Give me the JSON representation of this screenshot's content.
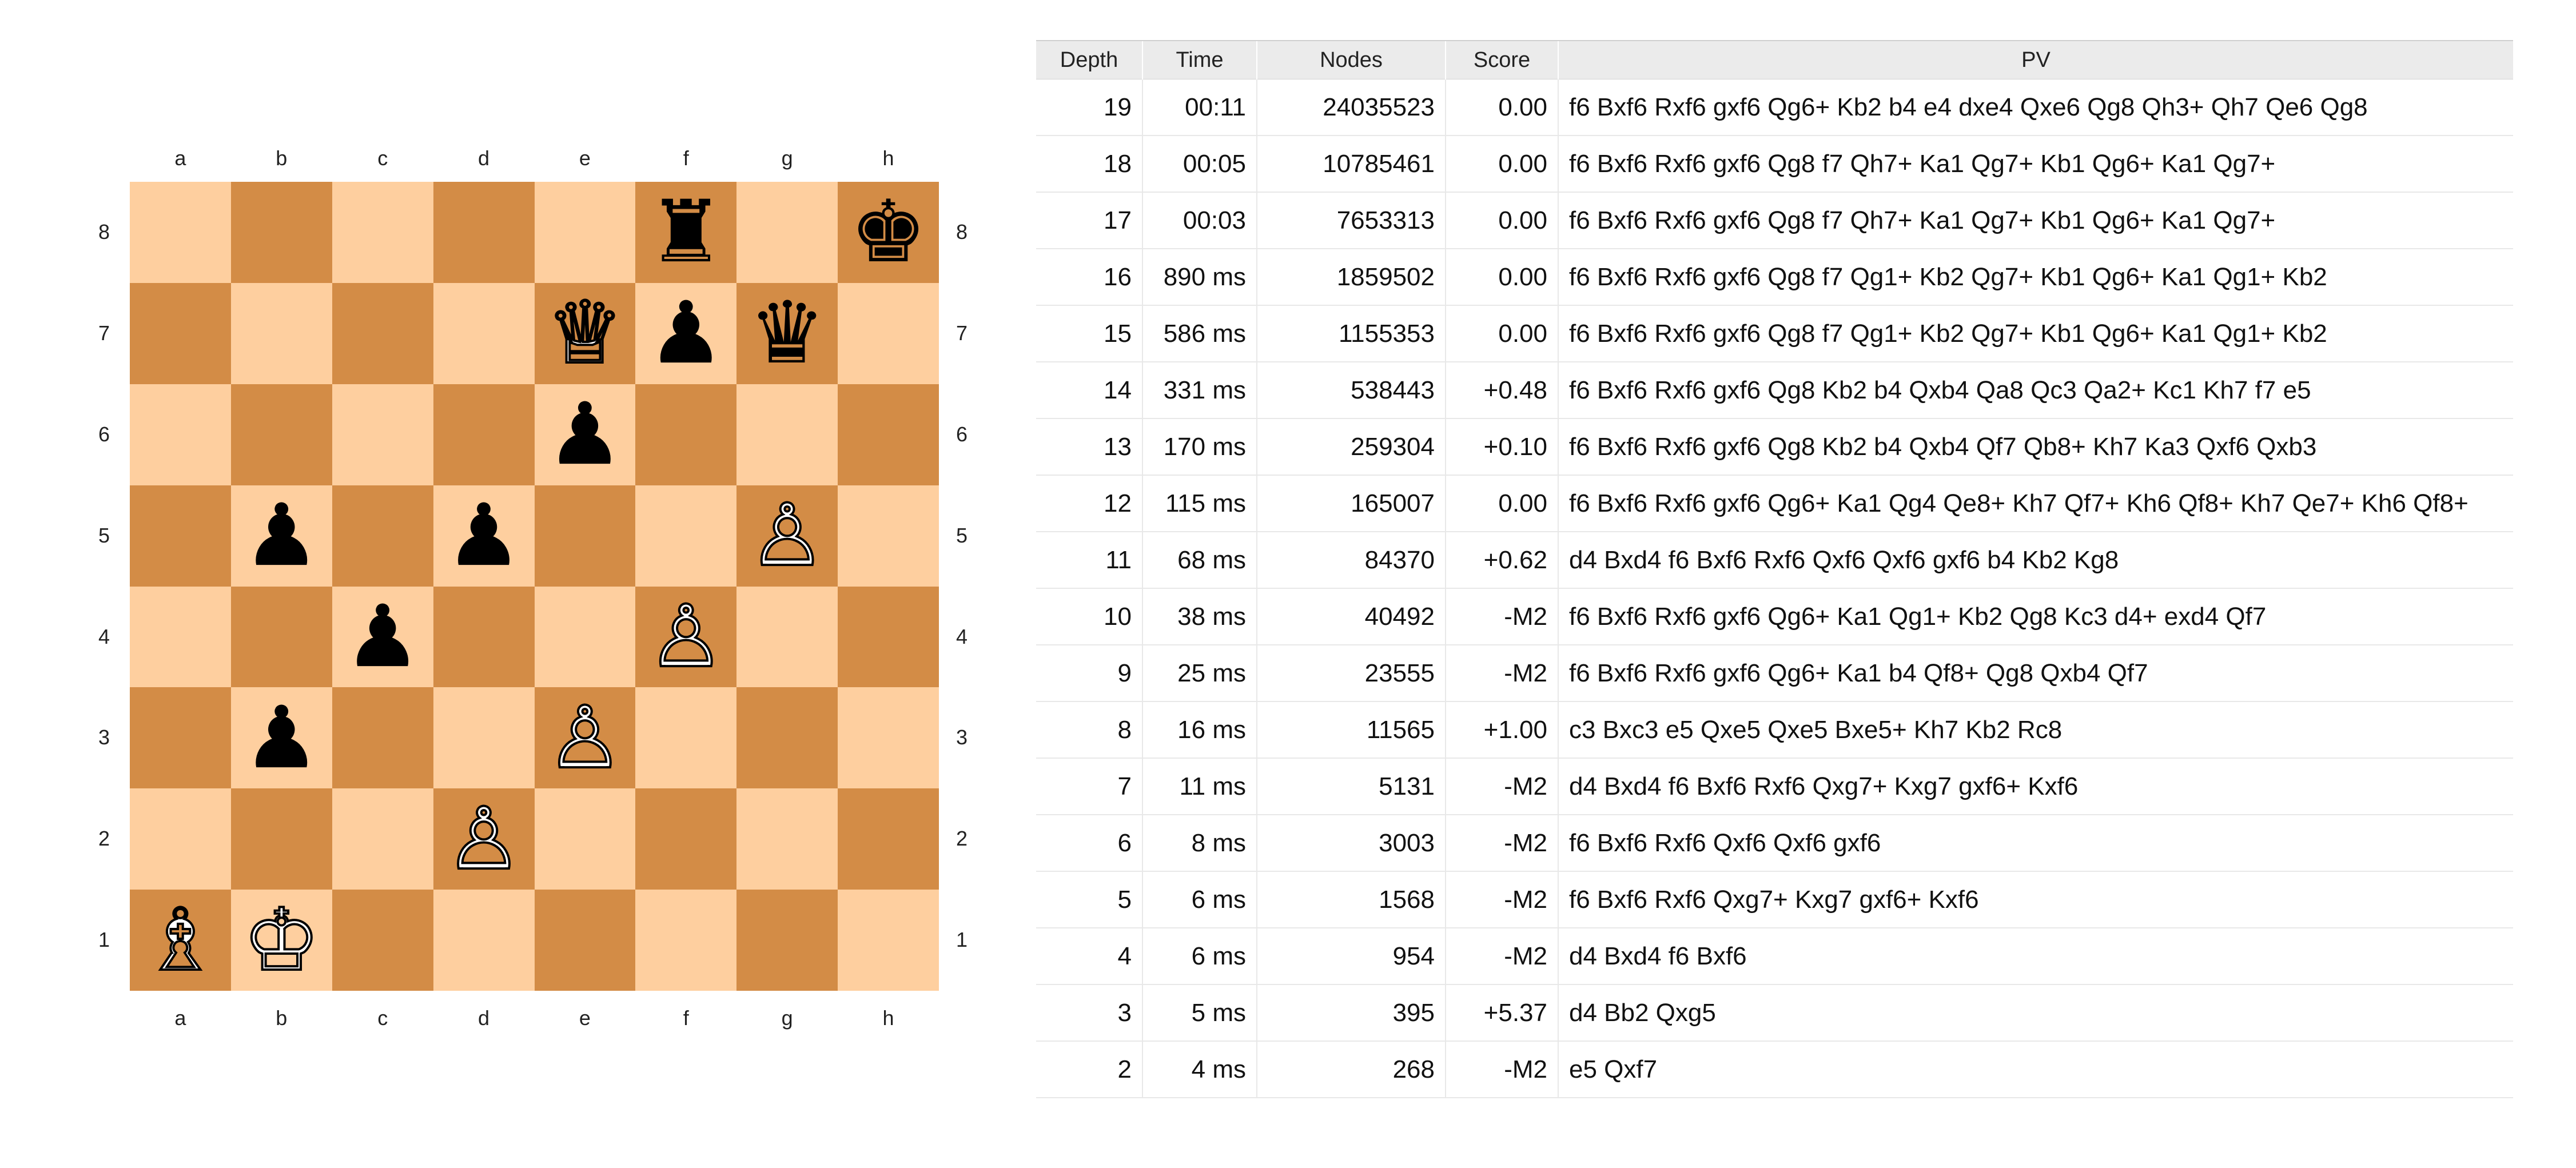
{
  "board": {
    "files": [
      "a",
      "b",
      "c",
      "d",
      "e",
      "f",
      "g",
      "h"
    ],
    "ranks": [
      "8",
      "7",
      "6",
      "5",
      "4",
      "3",
      "2",
      "1"
    ],
    "pieces": {
      "f8": {
        "color": "black",
        "type": "rook",
        "glyph": "♜"
      },
      "h8": {
        "color": "black",
        "type": "king",
        "glyph": "♚"
      },
      "e7": {
        "color": "white",
        "type": "queen",
        "glyph": "♕"
      },
      "f7": {
        "color": "black",
        "type": "pawn",
        "glyph": "♟"
      },
      "g7": {
        "color": "black",
        "type": "queen",
        "glyph": "♛"
      },
      "e6": {
        "color": "black",
        "type": "pawn",
        "glyph": "♟"
      },
      "b5": {
        "color": "black",
        "type": "pawn",
        "glyph": "♟"
      },
      "d5": {
        "color": "black",
        "type": "pawn",
        "glyph": "♟"
      },
      "g5": {
        "color": "white",
        "type": "pawn",
        "glyph": "♙"
      },
      "c4": {
        "color": "black",
        "type": "pawn",
        "glyph": "♟"
      },
      "f4": {
        "color": "white",
        "type": "pawn",
        "glyph": "♙"
      },
      "b3": {
        "color": "black",
        "type": "pawn",
        "glyph": "♟"
      },
      "e3": {
        "color": "white",
        "type": "pawn",
        "glyph": "♙"
      },
      "d2": {
        "color": "white",
        "type": "pawn",
        "glyph": "♙"
      },
      "a1": {
        "color": "white",
        "type": "bishop",
        "glyph": "♗"
      },
      "b1": {
        "color": "white",
        "type": "king",
        "glyph": "♔"
      }
    },
    "colors": {
      "light": "#fecf9f",
      "dark": "#d38c46"
    }
  },
  "table": {
    "headers": {
      "depth": "Depth",
      "time": "Time",
      "nodes": "Nodes",
      "score": "Score",
      "pv": "PV"
    },
    "rows": [
      {
        "depth": "19",
        "time": "00:11",
        "nodes": "24035523",
        "score": "0.00",
        "pv": "f6 Bxf6 Rxf6 gxf6 Qg6+ Kb2 b4 e4 dxe4 Qxe6 Qg8 Qh3+ Qh7 Qe6 Qg8"
      },
      {
        "depth": "18",
        "time": "00:05",
        "nodes": "10785461",
        "score": "0.00",
        "pv": "f6 Bxf6 Rxf6 gxf6 Qg8 f7 Qh7+ Ka1 Qg7+ Kb1 Qg6+ Ka1 Qg7+"
      },
      {
        "depth": "17",
        "time": "00:03",
        "nodes": "7653313",
        "score": "0.00",
        "pv": "f6 Bxf6 Rxf6 gxf6 Qg8 f7 Qh7+ Ka1 Qg7+ Kb1 Qg6+ Ka1 Qg7+"
      },
      {
        "depth": "16",
        "time": "890 ms",
        "nodes": "1859502",
        "score": "0.00",
        "pv": "f6 Bxf6 Rxf6 gxf6 Qg8 f7 Qg1+ Kb2 Qg7+ Kb1 Qg6+ Ka1 Qg1+ Kb2"
      },
      {
        "depth": "15",
        "time": "586 ms",
        "nodes": "1155353",
        "score": "0.00",
        "pv": "f6 Bxf6 Rxf6 gxf6 Qg8 f7 Qg1+ Kb2 Qg7+ Kb1 Qg6+ Ka1 Qg1+ Kb2"
      },
      {
        "depth": "14",
        "time": "331 ms",
        "nodes": "538443",
        "score": "+0.48",
        "pv": "f6 Bxf6 Rxf6 gxf6 Qg8 Kb2 b4 Qxb4 Qa8 Qc3 Qa2+ Kc1 Kh7 f7 e5"
      },
      {
        "depth": "13",
        "time": "170 ms",
        "nodes": "259304",
        "score": "+0.10",
        "pv": "f6 Bxf6 Rxf6 gxf6 Qg8 Kb2 b4 Qxb4 Qf7 Qb8+ Kh7 Ka3 Qxf6 Qxb3"
      },
      {
        "depth": "12",
        "time": "115 ms",
        "nodes": "165007",
        "score": "0.00",
        "pv": "f6 Bxf6 Rxf6 gxf6 Qg6+ Ka1 Qg4 Qe8+ Kh7 Qf7+ Kh6 Qf8+ Kh7 Qe7+ Kh6 Qf8+"
      },
      {
        "depth": "11",
        "time": "68 ms",
        "nodes": "84370",
        "score": "+0.62",
        "pv": "d4 Bxd4 f6 Bxf6 Rxf6 Qxf6 Qxf6 gxf6 b4 Kb2 Kg8"
      },
      {
        "depth": "10",
        "time": "38 ms",
        "nodes": "40492",
        "score": "-M2",
        "pv": "f6 Bxf6 Rxf6 gxf6 Qg6+ Ka1 Qg1+ Kb2 Qg8 Kc3 d4+ exd4 Qf7"
      },
      {
        "depth": "9",
        "time": "25 ms",
        "nodes": "23555",
        "score": "-M2",
        "pv": "f6 Bxf6 Rxf6 gxf6 Qg6+ Ka1 b4 Qf8+ Qg8 Qxb4 Qf7"
      },
      {
        "depth": "8",
        "time": "16 ms",
        "nodes": "11565",
        "score": "+1.00",
        "pv": "c3 Bxc3 e5 Qxe5 Qxe5 Bxe5+ Kh7 Kb2 Rc8"
      },
      {
        "depth": "7",
        "time": "11 ms",
        "nodes": "5131",
        "score": "-M2",
        "pv": "d4 Bxd4 f6 Bxf6 Rxf6 Qxg7+ Kxg7 gxf6+ Kxf6"
      },
      {
        "depth": "6",
        "time": "8 ms",
        "nodes": "3003",
        "score": "-M2",
        "pv": "f6 Bxf6 Rxf6 Qxf6 Qxf6 gxf6"
      },
      {
        "depth": "5",
        "time": "6 ms",
        "nodes": "1568",
        "score": "-M2",
        "pv": "f6 Bxf6 Rxf6 Qxg7+ Kxg7 gxf6+ Kxf6"
      },
      {
        "depth": "4",
        "time": "6 ms",
        "nodes": "954",
        "score": "-M2",
        "pv": "d4 Bxd4 f6 Bxf6"
      },
      {
        "depth": "3",
        "time": "5 ms",
        "nodes": "395",
        "score": "+5.37",
        "pv": "d4 Bb2 Qxg5"
      },
      {
        "depth": "2",
        "time": "4 ms",
        "nodes": "268",
        "score": "-M2",
        "pv": "e5 Qxf7"
      }
    ]
  }
}
